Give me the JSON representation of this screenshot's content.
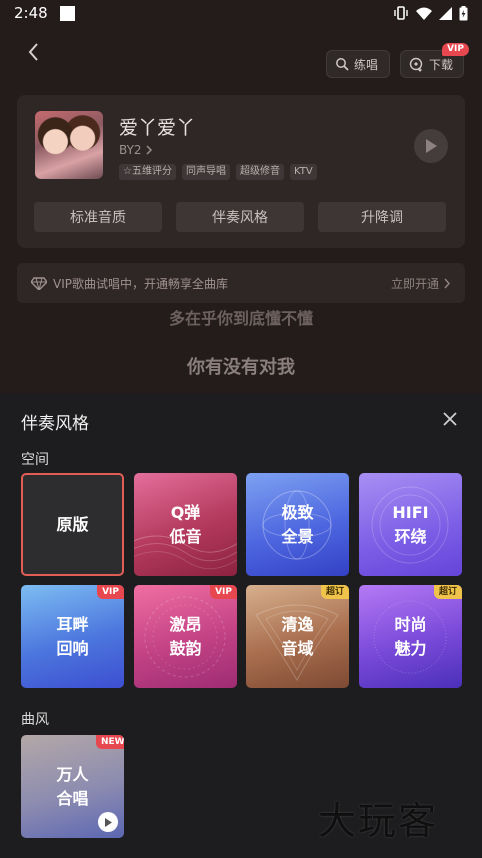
{
  "status_bar": {
    "time": "2:48"
  },
  "header": {
    "practice_label": "练唱",
    "download_label": "下载",
    "download_badge": "VIP"
  },
  "song": {
    "title": "爱丫爱丫",
    "singer": "BY2",
    "tags": [
      "☆五维评分",
      "同声导唱",
      "超级修音",
      "KTV"
    ],
    "options": [
      "标准音质",
      "伴奏风格",
      "升降调"
    ]
  },
  "vip_banner": {
    "message": "VIP歌曲试唱中，开通畅享全曲库",
    "action": "立即开通"
  },
  "lyrics": {
    "line1": "多在乎你到底懂不懂",
    "line2": "你有没有对我"
  },
  "sheet": {
    "title": "伴奏风格",
    "section_space": "空间",
    "section_genre": "曲风",
    "tiles": {
      "orig": {
        "label": "原版"
      },
      "q": {
        "label": "Q弹\n低音"
      },
      "pano": {
        "label": "极致\n全景"
      },
      "hifi": {
        "label": "HIFI\n环绕"
      },
      "ear": {
        "label": "耳畔\n回响",
        "badge": "VIP"
      },
      "drum": {
        "label": "激昂\n鼓韵",
        "badge": "VIP"
      },
      "clear": {
        "label": "清逸\n音域",
        "badge": "超订"
      },
      "fash": {
        "label": "时尚\n魅力",
        "badge": "超订"
      },
      "choir": {
        "label": "万人\n合唱",
        "badge": "NEW"
      }
    }
  },
  "watermark": "大玩客",
  "colors": {
    "accent_red": "#e7474f",
    "selected_border": "#e35d57",
    "super_badge": "#f0c44a"
  }
}
